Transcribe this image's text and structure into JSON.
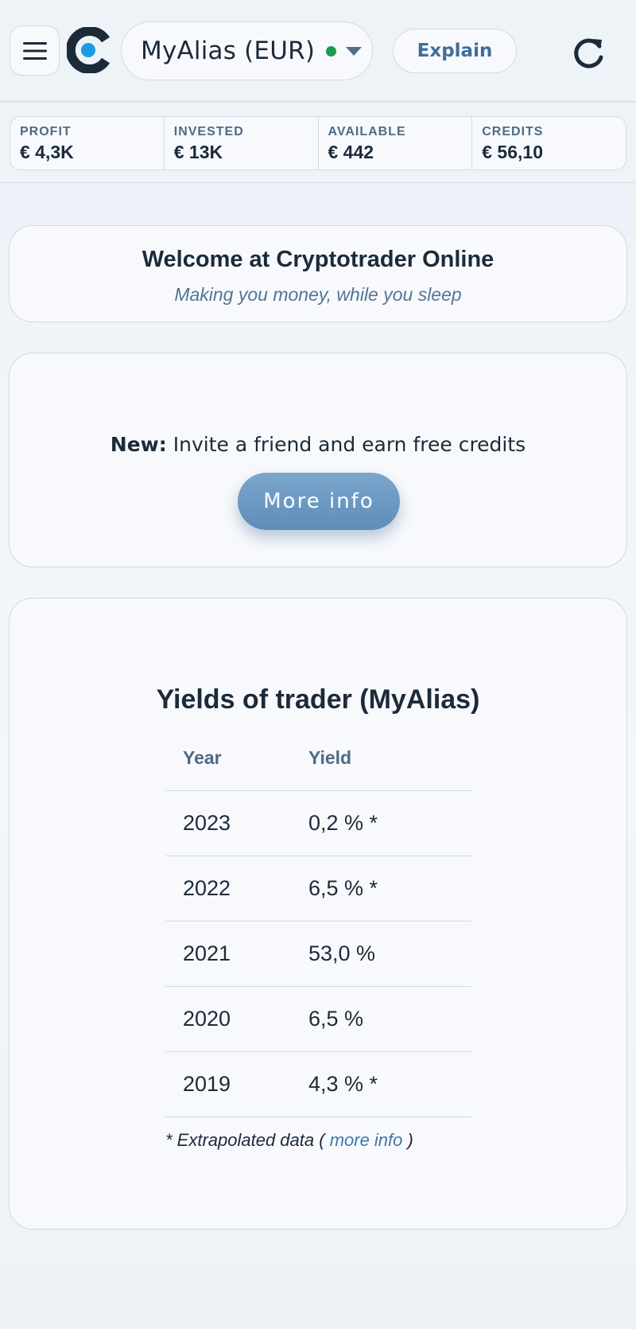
{
  "header": {
    "account_name": "MyAlias (EUR)",
    "explain_label": "Explain",
    "icons": {
      "menu": "hamburger-menu-icon",
      "logo": "cryptotrader-logo",
      "status": "online-status-dot",
      "dropdown": "chevron-down-icon",
      "refresh": "refresh-icon"
    },
    "status_color": "#1f9a53"
  },
  "stats": [
    {
      "label": "PROFIT",
      "value": "€ 4,3K"
    },
    {
      "label": "INVESTED",
      "value": "€ 13K"
    },
    {
      "label": "AVAILABLE",
      "value": "€ 442"
    },
    {
      "label": "CREDITS",
      "value": "€ 56,10"
    }
  ],
  "welcome": {
    "title": "Welcome at Cryptotrader Online",
    "subtitle": "Making you money, while you sleep"
  },
  "promo": {
    "prefix": "New:",
    "text": " Invite a friend and earn free credits",
    "button_label": "More info"
  },
  "yields": {
    "title": "Yields of trader (MyAlias)",
    "columns": [
      "Year",
      "Yield"
    ],
    "rows": [
      {
        "year": "2023",
        "yield": "0,2 % *"
      },
      {
        "year": "2022",
        "yield": "6,5 % *"
      },
      {
        "year": "2021",
        "yield": "53,0 %"
      },
      {
        "year": "2020",
        "yield": "6,5 %"
      },
      {
        "year": "2019",
        "yield": "4,3 % *"
      }
    ],
    "footnote_prefix": "* Extrapolated data ( ",
    "footnote_link": "more info",
    "footnote_suffix": " )"
  },
  "colors": {
    "accent": "#3f6e99",
    "button_gradient_top": "#7ba6cd",
    "button_gradient_bottom": "#5e8db9",
    "text": "#1c2a3a",
    "border": "#cfdbe7"
  }
}
